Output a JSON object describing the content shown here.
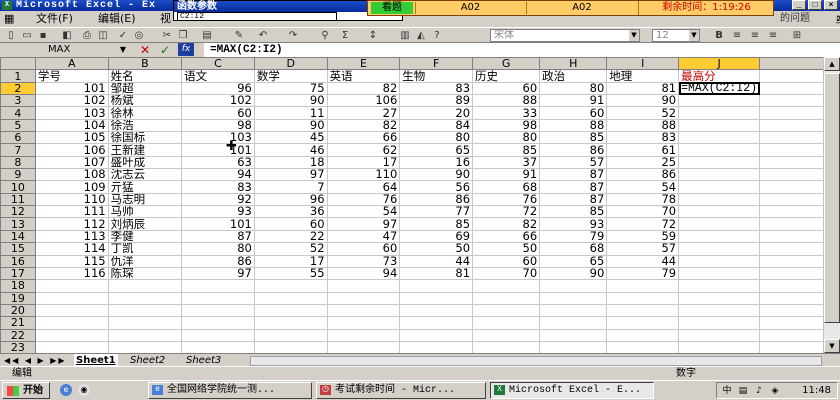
{
  "window": {
    "title": "Microsoft Excel - Ex",
    "icon": "excel-icon",
    "controls": [
      "minimize",
      "maximize",
      "close"
    ]
  },
  "menu": {
    "file": "文件(F)",
    "edit": "编辑(E)",
    "view": "视"
  },
  "dialog": {
    "title": "函数参数",
    "range": "C2:I2"
  },
  "exam": {
    "status": "看题",
    "q1": "A02",
    "q2": "A02",
    "timer": "剩余时间：1:19:26"
  },
  "toolbar": {
    "font_name": "宋体",
    "font_size": "12",
    "partial_text": "的问题"
  },
  "formula_bar": {
    "name_box": "MAX",
    "formula": "=MAX(C2:I2)"
  },
  "columns": [
    "A",
    "B",
    "C",
    "D",
    "E",
    "F",
    "G",
    "H",
    "I",
    "J"
  ],
  "headers": [
    "学号",
    "姓名",
    "语文",
    "数学",
    "英语",
    "生物",
    "历史",
    "政治",
    "地理",
    "最高分"
  ],
  "rows": [
    {
      "id": "101",
      "name": "邹超",
      "s": [
        "96",
        "75",
        "82",
        "83",
        "60",
        "80",
        "81"
      ]
    },
    {
      "id": "102",
      "name": "杨斌",
      "s": [
        "102",
        "90",
        "106",
        "89",
        "88",
        "91",
        "90"
      ]
    },
    {
      "id": "103",
      "name": "徐林",
      "s": [
        "60",
        "11",
        "27",
        "20",
        "33",
        "60",
        "52"
      ]
    },
    {
      "id": "104",
      "name": "徐浩",
      "s": [
        "98",
        "90",
        "82",
        "84",
        "98",
        "88",
        "88"
      ]
    },
    {
      "id": "105",
      "name": "徐国标",
      "s": [
        "103",
        "45",
        "66",
        "80",
        "80",
        "85",
        "83"
      ]
    },
    {
      "id": "106",
      "name": "王新建",
      "s": [
        "101",
        "46",
        "62",
        "65",
        "85",
        "86",
        "61"
      ]
    },
    {
      "id": "107",
      "name": "盛叶成",
      "s": [
        "63",
        "18",
        "17",
        "16",
        "37",
        "57",
        "25"
      ]
    },
    {
      "id": "108",
      "name": "沈志云",
      "s": [
        "94",
        "97",
        "110",
        "90",
        "91",
        "87",
        "86"
      ]
    },
    {
      "id": "109",
      "name": "亓猛",
      "s": [
        "83",
        "7",
        "64",
        "56",
        "68",
        "87",
        "54"
      ]
    },
    {
      "id": "110",
      "name": "马志明",
      "s": [
        "92",
        "96",
        "76",
        "86",
        "76",
        "87",
        "78"
      ]
    },
    {
      "id": "111",
      "name": "马帅",
      "s": [
        "93",
        "36",
        "54",
        "77",
        "72",
        "85",
        "70"
      ]
    },
    {
      "id": "112",
      "name": "刘炳辰",
      "s": [
        "101",
        "60",
        "97",
        "85",
        "82",
        "93",
        "72"
      ]
    },
    {
      "id": "113",
      "name": "李健",
      "s": [
        "87",
        "22",
        "47",
        "69",
        "66",
        "79",
        "59"
      ]
    },
    {
      "id": "114",
      "name": "丁凯",
      "s": [
        "80",
        "52",
        "60",
        "50",
        "50",
        "68",
        "57"
      ]
    },
    {
      "id": "115",
      "name": "仇洋",
      "s": [
        "86",
        "17",
        "73",
        "44",
        "60",
        "65",
        "44"
      ]
    },
    {
      "id": "116",
      "name": "陈琛",
      "s": [
        "97",
        "55",
        "94",
        "81",
        "70",
        "90",
        "79"
      ]
    }
  ],
  "row_numbers": [
    "1",
    "2",
    "3",
    "4",
    "5",
    "6",
    "7",
    "8",
    "9",
    "10",
    "11",
    "12",
    "13",
    "14",
    "15",
    "16",
    "17",
    "18",
    "19",
    "20",
    "21",
    "22",
    "23"
  ],
  "edit_cell_value": "=MAX(C2:I2)",
  "sheets": [
    "Sheet1",
    "Sheet2",
    "Sheet3"
  ],
  "status": {
    "mode": "编辑",
    "numlock": "数字"
  },
  "taskbar": {
    "start": "开始",
    "tasks": [
      "全国网络学院统一测...",
      "考试剩余时间 - Micr...",
      "Microsoft Excel - E..."
    ],
    "clock": "11:48"
  },
  "colors": {
    "title_blue": "#0a2a9c",
    "max_label": "#cc0000",
    "exam_bar": "#ffcc66",
    "status_green": "#33cc33"
  }
}
